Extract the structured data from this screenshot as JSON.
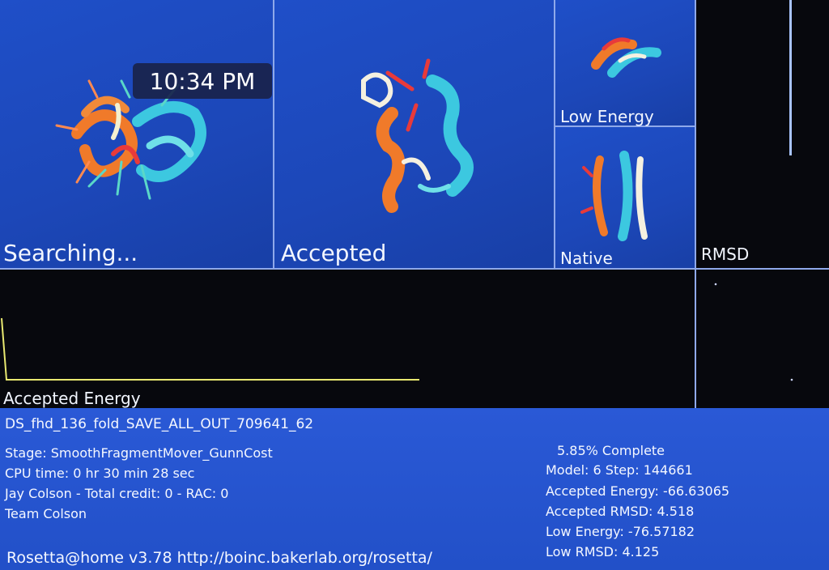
{
  "clock": "10:34 PM",
  "panels": {
    "searching": "Searching...",
    "accepted": "Accepted",
    "low_energy": "Low Energy",
    "native": "Native",
    "rmsd": "RMSD",
    "accepted_energy": "Accepted Energy"
  },
  "job_name": "DS_fhd_136_fold_SAVE_ALL_OUT_709641_62",
  "left_info": {
    "stage": "Stage: SmoothFragmentMover_GunnCost",
    "cpu_time": "CPU time: 0 hr 30 min 28 sec",
    "user": "Jay Colson - Total credit: 0 - RAC: 0",
    "team": "Team Colson"
  },
  "right_info": {
    "complete": "5.85% Complete",
    "model_step": "Model: 6  Step: 144661",
    "accepted_energy": "Accepted Energy: -66.63065",
    "accepted_rmsd": "Accepted RMSD:  4.518",
    "low_energy": "Low Energy: -76.57182",
    "low_rmsd": "Low RMSD:  4.125"
  },
  "footer": "Rosetta@home v3.78 http://boinc.bakerlab.org/rosetta/",
  "colors": {
    "panel_blue": "#1f4fc8",
    "graph_line": "#e8e870",
    "helix_orange": "#f07a2a",
    "helix_cyan": "#3cc8e0",
    "helix_red": "#e83a3a"
  }
}
